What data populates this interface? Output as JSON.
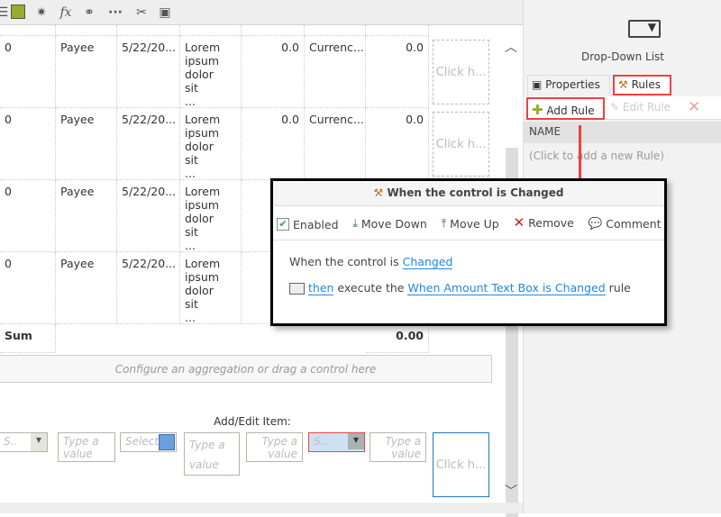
{
  "toolbar": {
    "icons": [
      "list-icon",
      "image-icon",
      "gear-icon",
      "function-icon",
      "link-icon",
      "more-icon",
      "tools-icon",
      "form-icon"
    ],
    "fx": "fx"
  },
  "rows": [
    {
      "c0": "0",
      "payee": "Payee",
      "date": "5/22/20...",
      "desc": "Lorem ipsum dolor sit ...",
      "amount": "0.0",
      "currency": "Currenc...",
      "value": "0.0",
      "click": "Click h..."
    },
    {
      "c0": "0",
      "payee": "Payee",
      "date": "5/22/20...",
      "desc": "Lorem ipsum dolor sit ...",
      "amount": "0.0",
      "currency": "Currenc...",
      "value": "0.0",
      "click": "Click h..."
    },
    {
      "c0": "0",
      "payee": "Payee",
      "date": "5/22/20...",
      "desc": "Lorem ipsum dolor sit ...",
      "amount": "",
      "currency": "",
      "value": "",
      "click": ""
    },
    {
      "c0": "0",
      "payee": "Payee",
      "date": "5/22/20...",
      "desc": "Lorem ipsum dolor sit ...",
      "amount": "",
      "currency": "",
      "value": "",
      "click": ""
    }
  ],
  "footer": {
    "sum_label": "Sum",
    "sum_value": "0.00",
    "aggregation_hint": "Configure an aggregation or drag a control here"
  },
  "edit": {
    "title": "Add/Edit Item:",
    "dropdown1": "S..",
    "text1": "Type a value",
    "date": "Select",
    "text2": "Type a value",
    "text3": "Type a value",
    "dropdown2": "S..",
    "text4": "Type a value",
    "click": "Click h..."
  },
  "panel": {
    "control_name": "Drop-Down List",
    "tabs": [
      "Properties",
      "Rules"
    ],
    "active_tab": "Rules",
    "add_rule": "Add Rule",
    "edit_rule": "Edit Rule",
    "column": "NAME",
    "empty": "(Click to add a new Rule)"
  },
  "dialog": {
    "title": "When the control is Changed",
    "actions": [
      "Enabled",
      "Move Down",
      "Move Up",
      "Remove",
      "Comment"
    ],
    "enabled": true,
    "line1_prefix": "When the control is",
    "line1_link": "Changed",
    "line2_then": "then",
    "line2_mid": "execute the",
    "line2_link": "When Amount Text Box is Changed",
    "line2_suffix": "rule"
  },
  "colors": {
    "highlight": "#f04040",
    "link": "#1e88e5",
    "accent_plus": "#9aab2a"
  }
}
